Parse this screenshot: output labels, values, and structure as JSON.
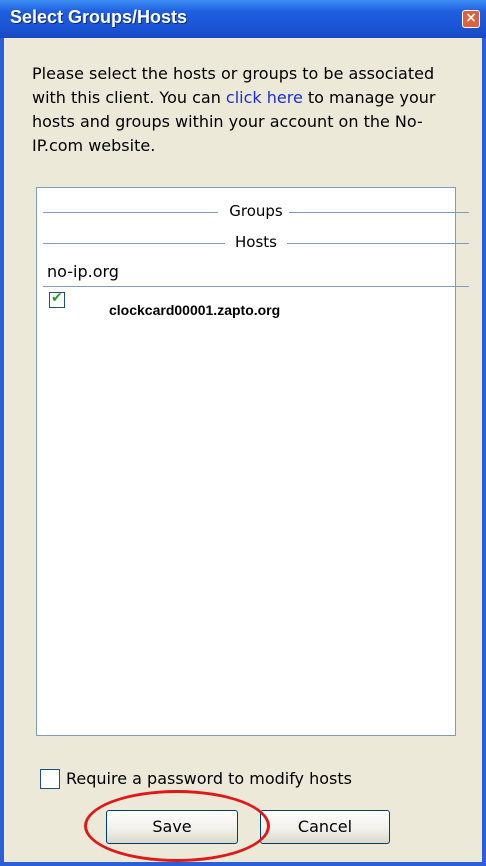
{
  "window": {
    "title": "Select Groups/Hosts",
    "close_glyph": "×"
  },
  "description": {
    "before_link": "Please select the hosts or groups to be associated with this client.  You can ",
    "link_text": "click here",
    "after_link": " to manage your hosts and groups within your account on the No-IP.com website."
  },
  "list": {
    "groups_header": "Groups",
    "hosts_header": "Hosts",
    "group_name": "no-ip.org",
    "hosts": [
      {
        "name": "clockcard00001.zapto.org",
        "checked": true
      }
    ]
  },
  "require_password": {
    "label": "Require a password to modify hosts",
    "checked": false
  },
  "buttons": {
    "save": "Save",
    "cancel": "Cancel"
  },
  "colors": {
    "titlebar": "#1f5fe0",
    "link": "#1b2fd0",
    "annotation": "#e01818"
  }
}
